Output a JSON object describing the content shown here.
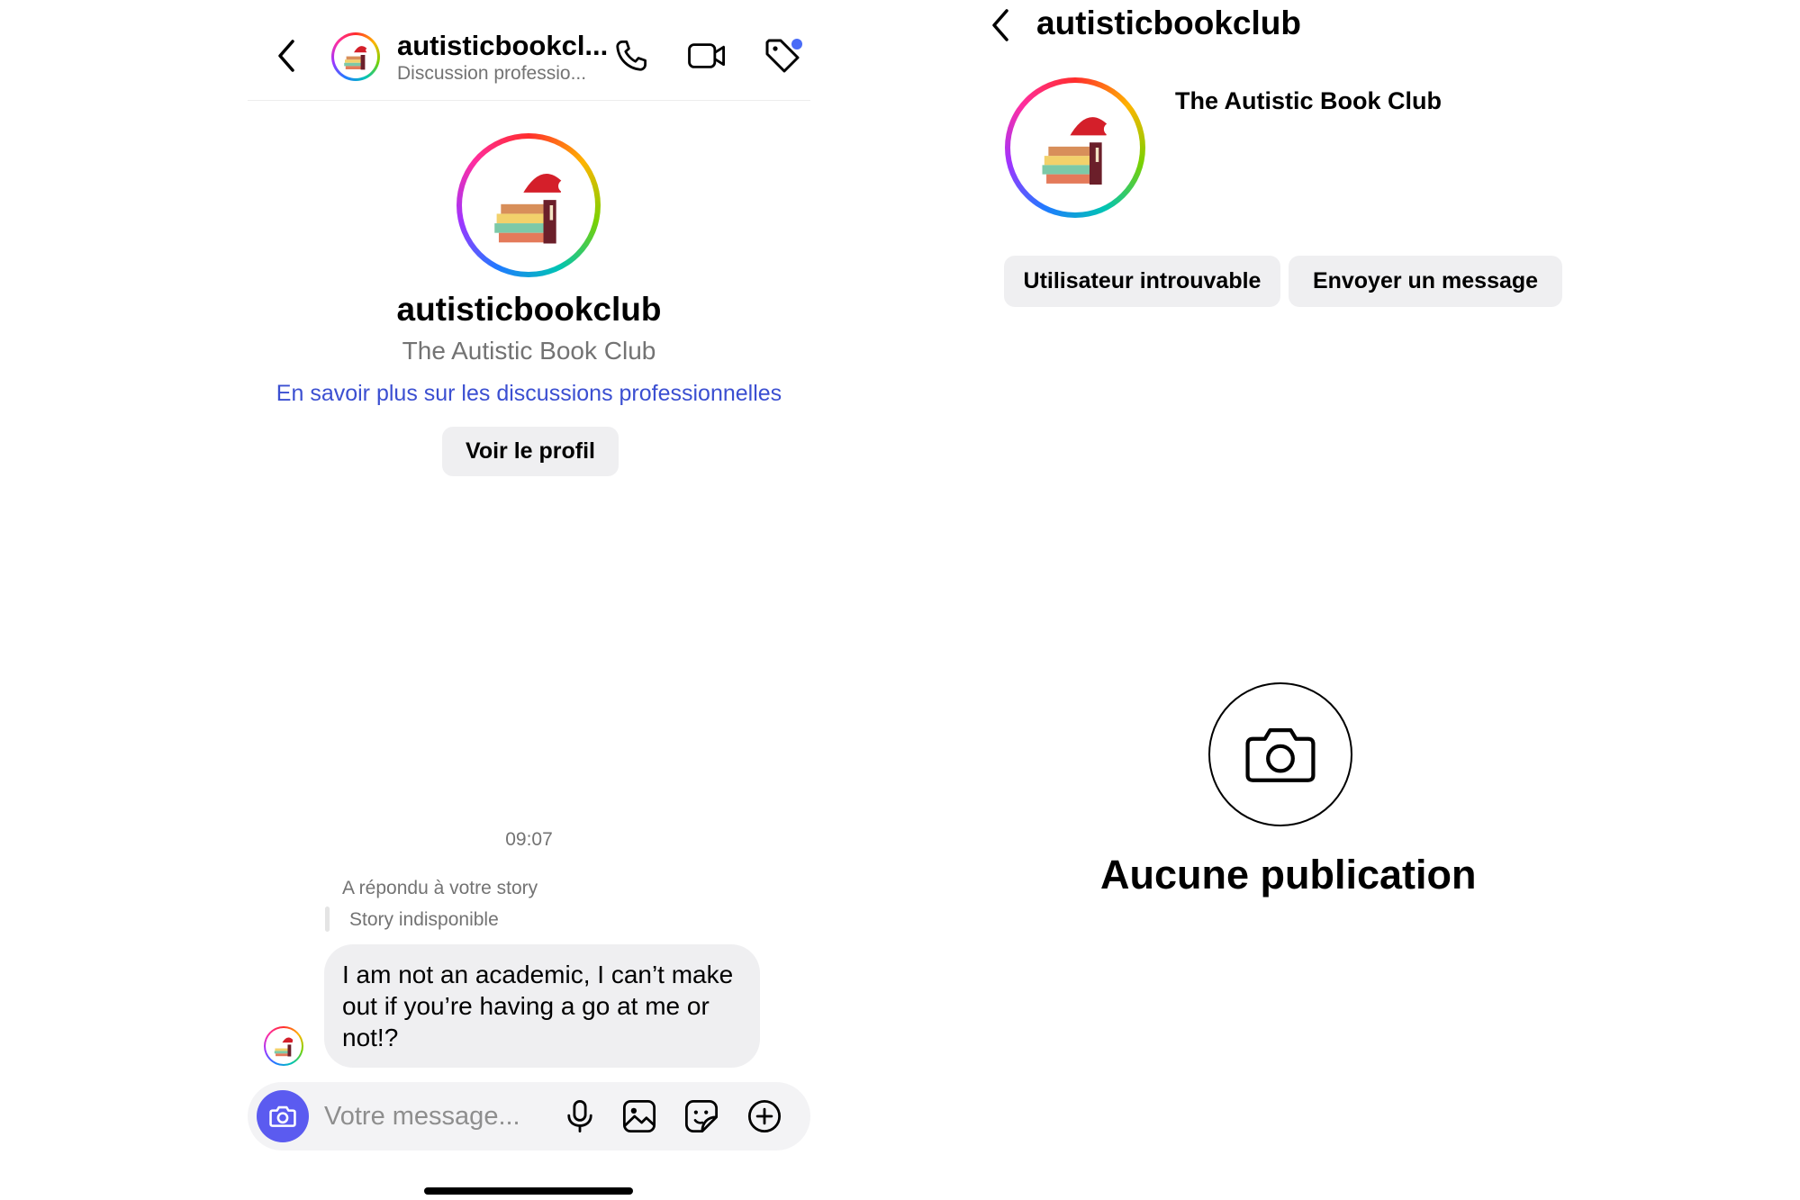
{
  "chat": {
    "header": {
      "username": "autisticbookcl...",
      "subtitle": "Discussion professio...",
      "icons": [
        "chevron-left-icon",
        "phone-icon",
        "video-camera-icon",
        "tag-icon"
      ]
    },
    "profile": {
      "username": "autisticbookclub",
      "full_name": "The Autistic Book Club",
      "learn_more_link": "En savoir plus sur les discussions professionnelles",
      "view_profile_button": "Voir le profil"
    },
    "messages": {
      "timestamp": "09:07",
      "reply_note": "A répondu à votre story",
      "story_status": "Story indisponible",
      "message_text": "I am not an academic, I can’t make out if you’re having a go at me or not!?"
    },
    "composer": {
      "placeholder": "Votre message...",
      "icons": [
        "camera-icon",
        "microphone-icon",
        "image-icon",
        "sticker-icon",
        "plus-circle-icon"
      ]
    },
    "colors": {
      "accent": "#5b5bf0",
      "link": "#3b4fd1",
      "notification_dot": "#4a6cf7"
    }
  },
  "profile": {
    "username": "autisticbookclub",
    "full_name": "The Autistic Book Club",
    "buttons": {
      "user_not_found": "Utilisateur introuvable",
      "send_message": "Envoyer un message"
    },
    "empty_state": {
      "title": "Aucune publication",
      "icon": "camera-icon"
    }
  }
}
